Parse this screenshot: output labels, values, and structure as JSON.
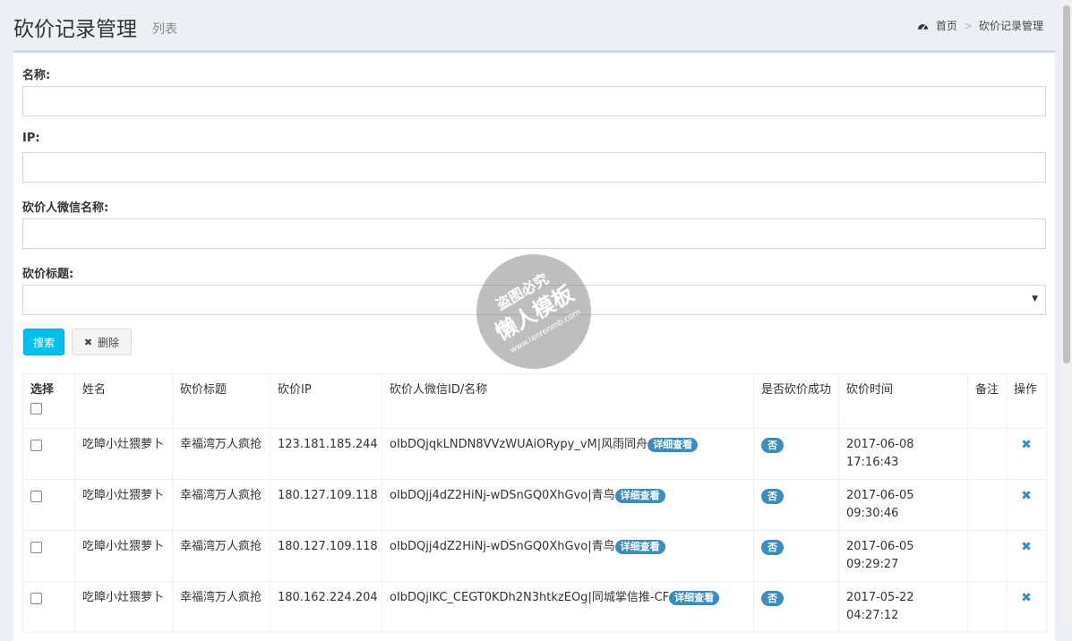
{
  "header": {
    "title": "砍价记录管理",
    "subtitle": "列表",
    "breadcrumb": {
      "home": "首页",
      "separator": ">",
      "current": "砍价记录管理"
    }
  },
  "form": {
    "name_label": "名称:",
    "ip_label": "IP:",
    "wechat_label": "砍价人微信名称:",
    "title_label": "砍价标题:",
    "name_value": "",
    "ip_value": "",
    "wechat_value": "",
    "title_value": ""
  },
  "buttons": {
    "search": "搜索",
    "delete": "删除"
  },
  "table": {
    "headers": {
      "select": "选择",
      "name": "姓名",
      "title": "砍价标题",
      "ip": "砍价IP",
      "wechat": "砍价人微信ID/名称",
      "success": "是否砍价成功",
      "time": "砍价时间",
      "note": "备注",
      "action": "操作"
    },
    "rows": [
      {
        "name": "吃暲小灶猥萝卜",
        "title": "幸福湾万人疯抢",
        "ip": "123.181.185.244",
        "wechat": "oIbDQjqkLNDN8VVzWUAiORypy_vM|风雨同舟",
        "detail": "详细查看",
        "success": "否",
        "time": "2017-06-08 17:16:43",
        "note": ""
      },
      {
        "name": "吃暲小灶猥萝卜",
        "title": "幸福湾万人疯抢",
        "ip": "180.127.109.118",
        "wechat": "oIbDQjj4dZ2HiNj-wDSnGQ0XhGvo|青鸟",
        "detail": "详细查看",
        "success": "否",
        "time": "2017-06-05 09:30:46",
        "note": ""
      },
      {
        "name": "吃暲小灶猥萝卜",
        "title": "幸福湾万人疯抢",
        "ip": "180.127.109.118",
        "wechat": "oIbDQjj4dZ2HiNj-wDSnGQ0XhGvo|青鸟",
        "detail": "详细查看",
        "success": "否",
        "time": "2017-06-05 09:29:27",
        "note": ""
      },
      {
        "name": "吃暲小灶猥萝卜",
        "title": "幸福湾万人疯抢",
        "ip": "180.162.224.204",
        "wechat": "oIbDQjlKC_CEGT0KDh2N3htkzEOg|同城掌信推-CF",
        "detail": "详细查看",
        "success": "否",
        "time": "2017-05-22 04:27:12",
        "note": ""
      }
    ]
  },
  "watermark": {
    "line1": "盗图必究",
    "line2": "懒人模板",
    "line3": "www.lanrenmb.com"
  },
  "colors": {
    "background": "#ecf0f5",
    "accent": "#3c8dbc",
    "search_button": "#00c0ef",
    "box_border": "#d2d6de"
  }
}
